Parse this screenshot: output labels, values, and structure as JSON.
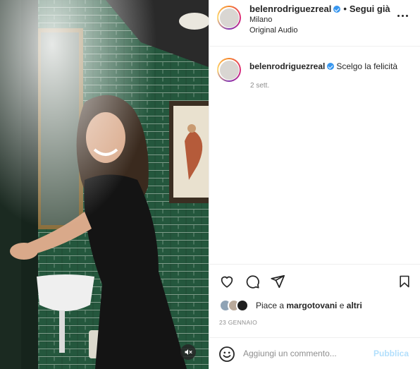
{
  "post": {
    "username": "belenrodriguezreal",
    "follow_label": "Segui già",
    "separator": "•",
    "location": "Milano",
    "audio": "Original Audio",
    "more_icon": "more-horizontal-icon"
  },
  "caption": {
    "username": "belenrodriguezreal",
    "text": "Scelgo la felicità",
    "time_ago": "2 sett."
  },
  "actions": {
    "icons": [
      "heart-icon",
      "comment-icon",
      "share-icon",
      "bookmark-icon"
    ],
    "likes_prefix": "Piace a",
    "likes_user": "margotovani",
    "likes_joiner": "e",
    "likes_others": "altri",
    "date": "23 GENNAIO"
  },
  "comment_box": {
    "placeholder": "Aggiungi un commento...",
    "publish_label": "Pubblica",
    "emoji_icon": "emoji-icon"
  },
  "media": {
    "mute_icon": "muted-speaker-icon"
  },
  "colors": {
    "verified": "#3897f0",
    "publish_disabled": "#b2dffc",
    "secondary_text": "#8e8e8e",
    "tile_green": "#1f4a34"
  }
}
